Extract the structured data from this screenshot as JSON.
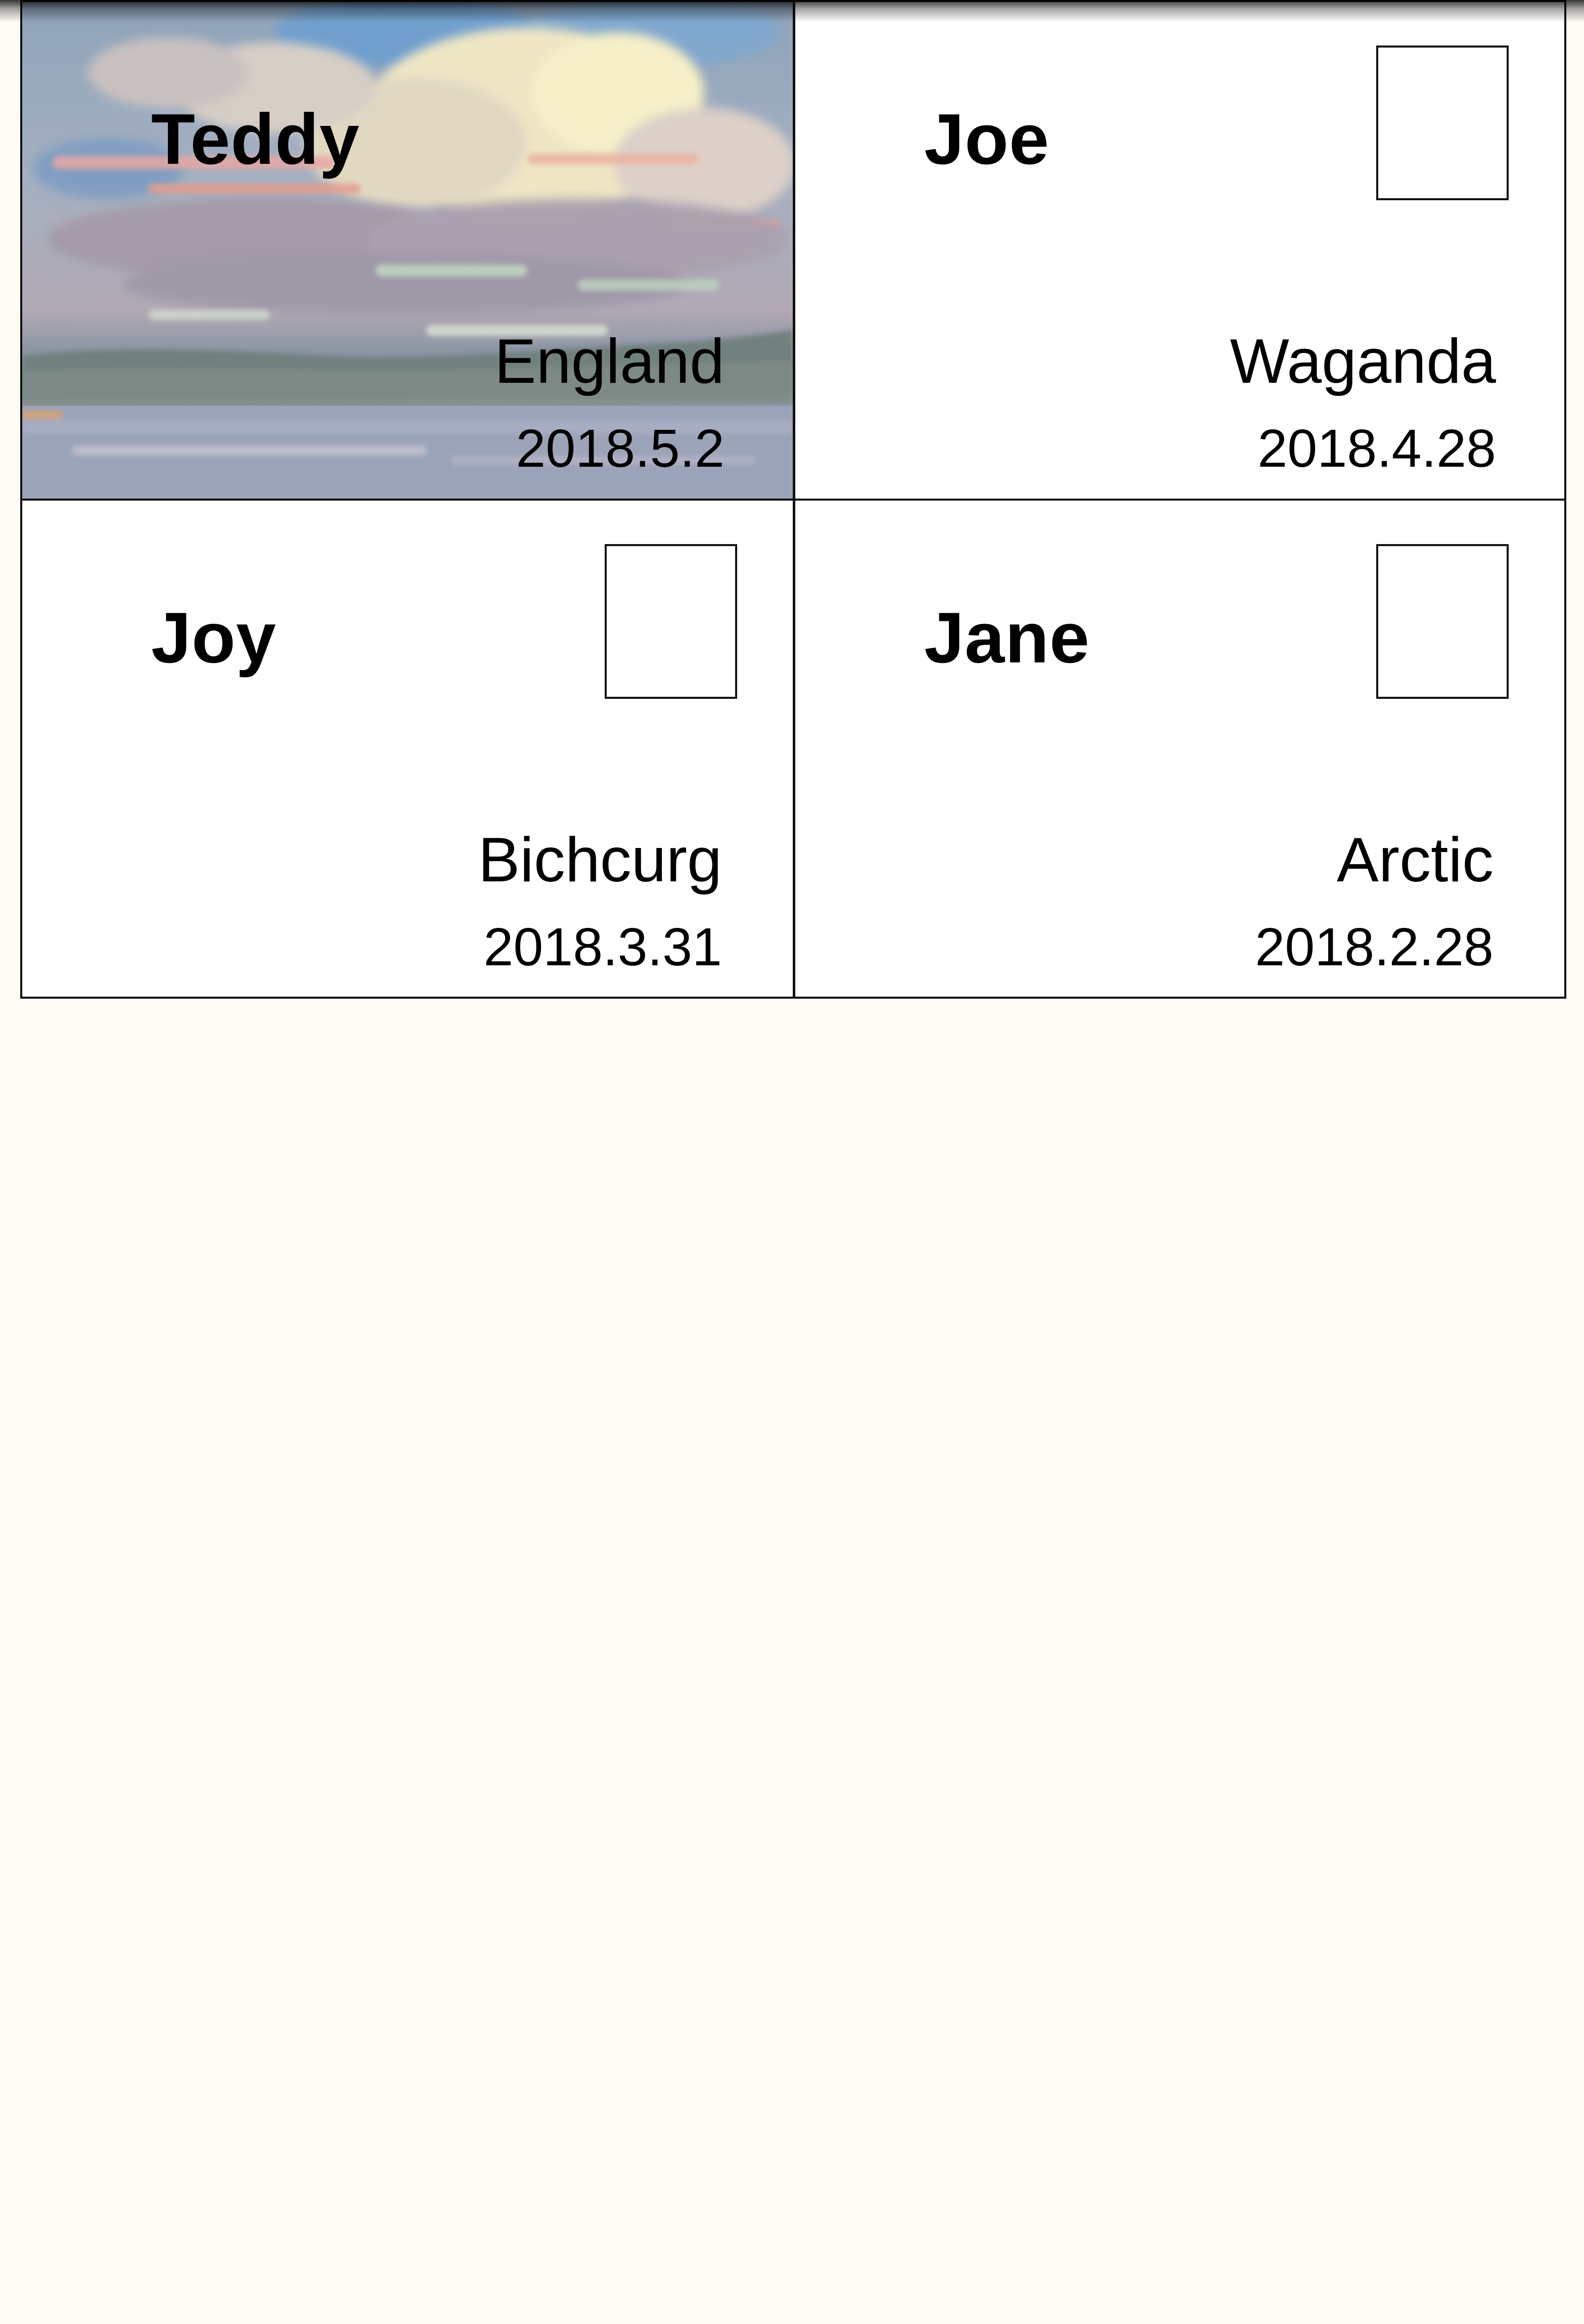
{
  "cards": [
    {
      "name": "Teddy",
      "place": "England",
      "date": "2018.5.2",
      "has_photo": true
    },
    {
      "name": "Joe",
      "place": "Waganda",
      "date": "2018.4.28",
      "has_photo": false
    },
    {
      "name": "Joy",
      "place": "Bichcurg",
      "date": "2018.3.31",
      "has_photo": false
    },
    {
      "name": "Jane",
      "place": "Arctic",
      "date": "2018.2.28",
      "has_photo": false
    }
  ],
  "colors": {
    "page_background": "#fdfbf4",
    "card_background": "#ffffff",
    "border": "#111111"
  },
  "icons": {
    "photo_placeholder": "image-placeholder-icon",
    "card_background_art": "cloudy-sky-painting"
  }
}
